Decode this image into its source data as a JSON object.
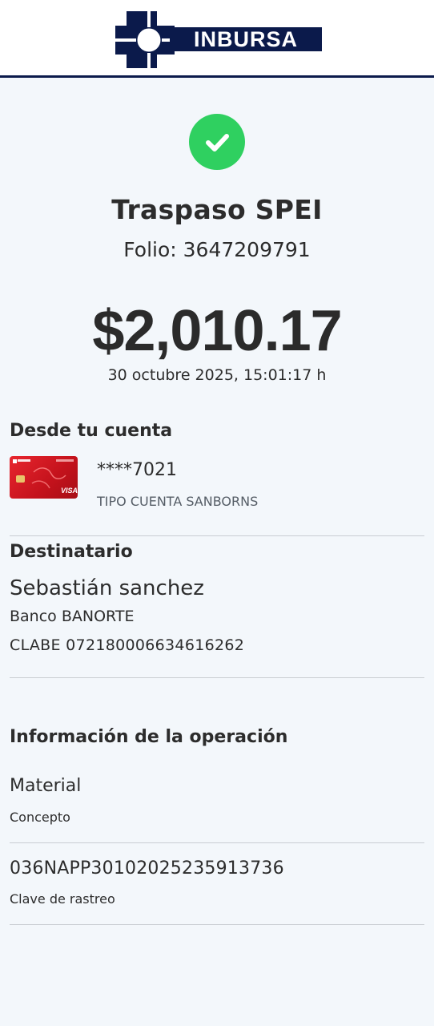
{
  "brand": {
    "name": "INBURSA",
    "color_navy": "#0b1a4b",
    "color_blue": "#1e2fa0"
  },
  "status": {
    "icon": "check-circle-icon",
    "color": "#2fd060"
  },
  "transfer": {
    "title": "Traspaso SPEI",
    "folio_label": "Folio:",
    "folio_number": "3647209791",
    "amount": "$2,010.17",
    "datetime": "30 octubre 2025, 15:01:17 h"
  },
  "origin": {
    "section_title": "Desde tu cuenta",
    "card_icon": "inbursa-sanborns-visa-card",
    "card_color": "#d91c24",
    "account_masked": "****7021",
    "account_type": "TIPO CUENTA SANBORNS"
  },
  "recipient": {
    "section_title": "Destinatario",
    "name": "Sebastián sanchez",
    "bank": "Banco BANORTE",
    "clabe": "CLABE 072180006634616262"
  },
  "operation": {
    "section_title": "Información de la operación",
    "concept_value": "Material",
    "concept_label": "Concepto",
    "tracking_value": "036NAPP30102025235913736",
    "tracking_label": "Clave de rastreo"
  }
}
